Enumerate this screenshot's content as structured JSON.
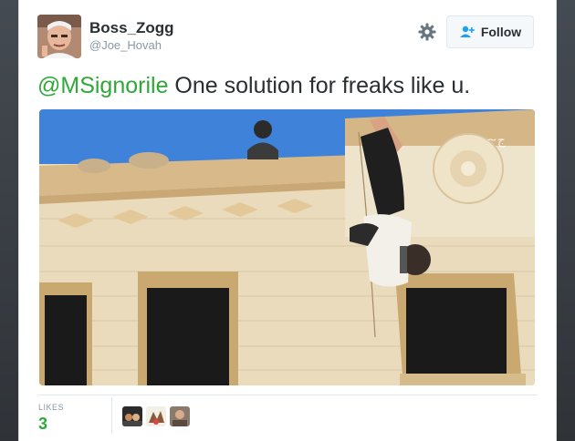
{
  "user": {
    "display_name": "Boss_Zogg",
    "handle": "@Joe_Hovah"
  },
  "actions": {
    "follow_label": "Follow"
  },
  "tweet": {
    "mention": "@MSignorile",
    "body": " One solution for freaks like u."
  },
  "stats": {
    "likes_label": "LIKES",
    "likes_count": "3"
  },
  "icons": {
    "settings": "gear-icon",
    "follow": "add-user-icon"
  },
  "colors": {
    "mention": "#2fa83a",
    "likes_count": "#2fa83a",
    "sky": "#3e7fd6"
  }
}
